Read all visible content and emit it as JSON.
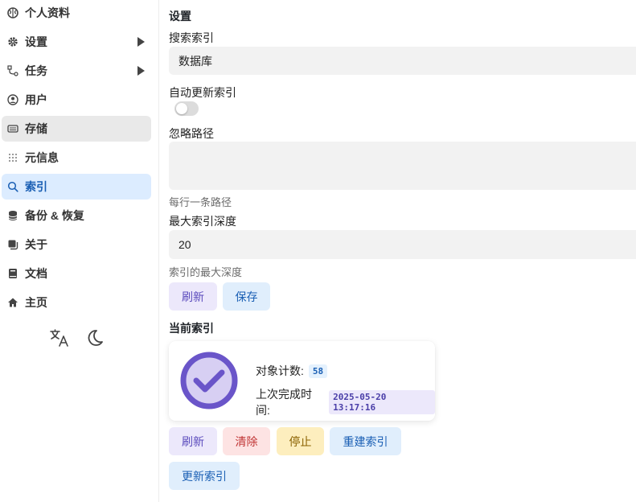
{
  "sidebar": {
    "items": [
      {
        "label": "个人资料",
        "icon": "brain-icon"
      },
      {
        "label": "设置",
        "icon": "gear-icon",
        "submenu": true
      },
      {
        "label": "任务",
        "icon": "route-icon",
        "submenu": true
      },
      {
        "label": "用户",
        "icon": "user-circle-icon"
      },
      {
        "label": "存储",
        "icon": "storage-icon",
        "state": "hover"
      },
      {
        "label": "元信息",
        "icon": "metadata-icon"
      },
      {
        "label": "索引",
        "icon": "search-icon",
        "state": "active"
      },
      {
        "label": "备份 & 恢复",
        "icon": "database-icon"
      },
      {
        "label": "关于",
        "icon": "about-icon"
      },
      {
        "label": "文档",
        "icon": "book-icon"
      },
      {
        "label": "主页",
        "icon": "home-icon"
      }
    ],
    "tools": [
      {
        "icon": "translate-icon"
      },
      {
        "icon": "moon-icon"
      }
    ]
  },
  "settings": {
    "title": "设置",
    "search_index_label": "搜索索引",
    "search_index_value": "数据库",
    "auto_update_label": "自动更新索引",
    "auto_update_enabled": false,
    "ignore_paths_label": "忽略路径",
    "ignore_paths_value": "",
    "ignore_paths_help": "每行一条路径",
    "max_depth_label": "最大索引深度",
    "max_depth_value": "20",
    "max_depth_help": "索引的最大深度",
    "refresh_label": "刷新",
    "save_label": "保存"
  },
  "current_index": {
    "title": "当前索引",
    "object_count_label": "对象计数:",
    "object_count_value": "58",
    "last_complete_label": "上次完成时间:",
    "last_complete_value": "2025-05-20 13:17:16",
    "status_icon": "check-circle-icon"
  },
  "actions": {
    "refresh_label": "刷新",
    "clear_label": "清除",
    "stop_label": "停止",
    "rebuild_label": "重建索引",
    "update_label": "更新索引"
  },
  "colors": {
    "active_bg": "#dcecff",
    "accent_blue": "#1a5fb4",
    "accent_purple": "#6a55c9"
  }
}
